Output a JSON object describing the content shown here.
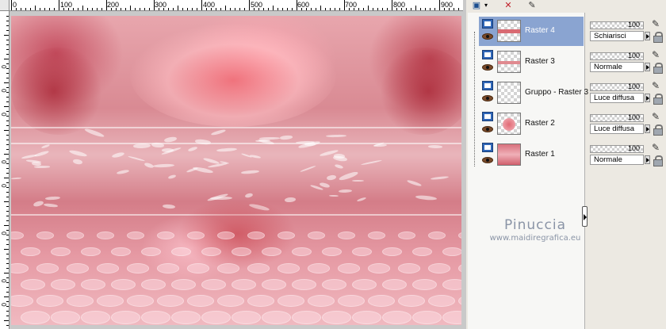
{
  "ruler": {
    "top_labels": [
      "0",
      "100",
      "200",
      "300",
      "400",
      "500",
      "600",
      "700",
      "800",
      "900"
    ],
    "left_labels": [
      "0",
      "0",
      "0",
      "0",
      "0",
      "0",
      "0",
      "0"
    ]
  },
  "toolbar": {
    "buttons": [
      {
        "icon": "layer-options-icon"
      },
      {
        "icon": "dropdown-arrow-icon"
      },
      {
        "icon": "delete-layer-icon"
      },
      {
        "icon": "edit-brush-icon"
      }
    ]
  },
  "layers": [
    {
      "name": "Raster 4",
      "selected": true,
      "opacity": "100",
      "blend": "Schiarisci"
    },
    {
      "name": "Raster 3",
      "selected": false,
      "opacity": "100",
      "blend": "Normale"
    },
    {
      "name": "Gruppo - Raster 3",
      "selected": false,
      "opacity": "100",
      "blend": "Luce diffusa"
    },
    {
      "name": "Raster 2",
      "selected": false,
      "opacity": "100",
      "blend": "Luce diffusa"
    },
    {
      "name": "Raster 1",
      "selected": false,
      "opacity": "100",
      "blend": "Normale"
    }
  ],
  "watermark": {
    "name": "Pinuccia",
    "url": "www.maidiregrafica.eu"
  },
  "colors": {
    "selection": "#8aa4d1",
    "panel": "#ece9e2"
  }
}
